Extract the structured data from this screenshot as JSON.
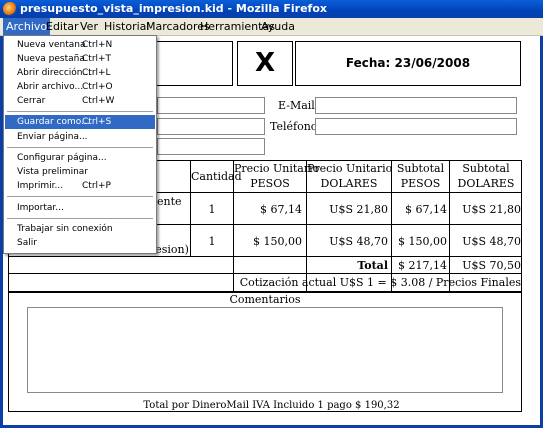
{
  "window": {
    "title": "presupuesto_vista_impresion.kid - Mozilla Firefox"
  },
  "menubar": {
    "items": [
      {
        "label": "Archivo"
      },
      {
        "label": "Editar"
      },
      {
        "label": "Ver"
      },
      {
        "label": "Historial"
      },
      {
        "label": "Marcadores"
      },
      {
        "label": "Herramientas"
      },
      {
        "label": "Ayuda"
      }
    ]
  },
  "file_menu": {
    "items": [
      {
        "label": "Nueva ventana",
        "shortcut": "Ctrl+N"
      },
      {
        "label": "Nueva pestaña",
        "shortcut": "Ctrl+T"
      },
      {
        "label": "Abrir dirección...",
        "shortcut": "Ctrl+L"
      },
      {
        "label": "Abrir archivo...",
        "shortcut": "Ctrl+O"
      },
      {
        "label": "Cerrar",
        "shortcut": "Ctrl+W"
      },
      {
        "label": "Guardar como...",
        "shortcut": "Ctrl+S"
      },
      {
        "label": "Enviar página...",
        "shortcut": ""
      },
      {
        "label": "Configurar página...",
        "shortcut": ""
      },
      {
        "label": "Vista preliminar",
        "shortcut": ""
      },
      {
        "label": "Imprimir...",
        "shortcut": "Ctrl+P"
      },
      {
        "label": "Importar...",
        "shortcut": ""
      },
      {
        "label": "Trabajar sin conexión",
        "shortcut": ""
      },
      {
        "label": "Salir",
        "shortcut": ""
      }
    ]
  },
  "document": {
    "mark": "X",
    "date": "Fecha: 23/06/2008",
    "email_label": "E-Mail",
    "phone_label": "Teléfono",
    "table": {
      "headers": [
        "Cantidad",
        "Precio Unitario PESOS",
        "Precio Unitario DOLARES",
        "Subtotal PESOS",
        "Subtotal DOLARES"
      ],
      "header_lines": [
        [
          "Cantidad"
        ],
        [
          "Precio Unitario",
          "PESOS"
        ],
        [
          "Precio Unitario",
          "DOLARES"
        ],
        [
          "Subtotal",
          "PESOS"
        ],
        [
          "Subtotal",
          "DOLARES"
        ]
      ],
      "rows": [
        {
          "desc": "ente",
          "qty": "1",
          "pu_pesos": "$ 67,14",
          "pu_dolares": "U$S 21,80",
          "st_pesos": "$ 67,14",
          "st_dolares": "U$S 21,80"
        },
        {
          "desc": "resion)",
          "qty": "1",
          "pu_pesos": "$ 150,00",
          "pu_dolares": "U$S 48,70",
          "st_pesos": "$ 150,00",
          "st_dolares": "U$S 48,70"
        }
      ],
      "total_label": "Total",
      "total_pesos": "$ 217,14",
      "total_dolares": "U$S 70,50",
      "quote": "Cotización actual U$S 1 = $ 3.08 / Precios Finales"
    },
    "comments_label": "Comentarios",
    "footer": "Total por DineroMail IVA Incluido     1 pago $ 190,32"
  }
}
